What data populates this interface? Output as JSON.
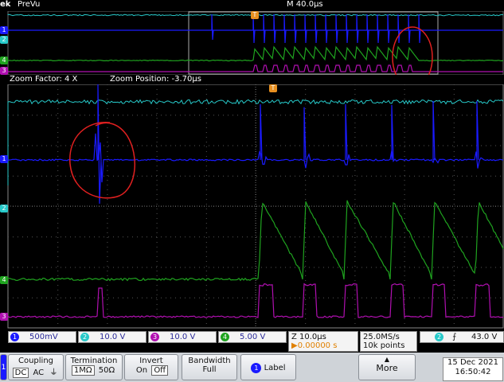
{
  "top_bar": {
    "brand": "ek",
    "mode": "PreVu",
    "timebase": "M 40.0µs"
  },
  "zoom": {
    "factor": "Zoom Factor: 4 X",
    "position": "Zoom Position: -3.70µs"
  },
  "channels": [
    {
      "num": "1",
      "value": "500mV",
      "color": "#1a1aff"
    },
    {
      "num": "2",
      "value": "10.0 V",
      "color": "#27c9c9"
    },
    {
      "num": "3",
      "value": "10.0 V",
      "color": "#b010b0"
    },
    {
      "num": "4",
      "value": "5.00 V",
      "color": "#1fa31f"
    }
  ],
  "zoom_timebase": {
    "scale": "Z 10.0µs",
    "delay": "▶0.00000 s"
  },
  "acquisition": {
    "rate": "25.0MS/s",
    "points": "10k points"
  },
  "trigger": {
    "channel": "2",
    "level": "43.0 V"
  },
  "softkeys": {
    "channel_badge": "1",
    "coupling": {
      "title": "Coupling",
      "options": [
        "DC",
        "AC",
        "⏚"
      ]
    },
    "termination": {
      "title": "Termination",
      "options": [
        "1MΩ",
        "50Ω"
      ]
    },
    "invert": {
      "title": "Invert",
      "options": [
        "On",
        "Off"
      ]
    },
    "bandwidth": {
      "title": "Bandwidth",
      "value": "Full"
    },
    "label": {
      "badge": "1",
      "title": "Label"
    },
    "more": "More"
  },
  "clock": {
    "date": "15 Dec  2021",
    "time": "16:50:42"
  },
  "markers": {
    "ch1": "1",
    "ch2": "2",
    "ch3": "3",
    "ch4": "4",
    "trigger": "T"
  },
  "colors": {
    "ch1": "#1a1aff",
    "ch2": "#27c9c9",
    "ch3": "#b010b0",
    "ch4": "#1fa31f",
    "annotation": "#e02020"
  }
}
